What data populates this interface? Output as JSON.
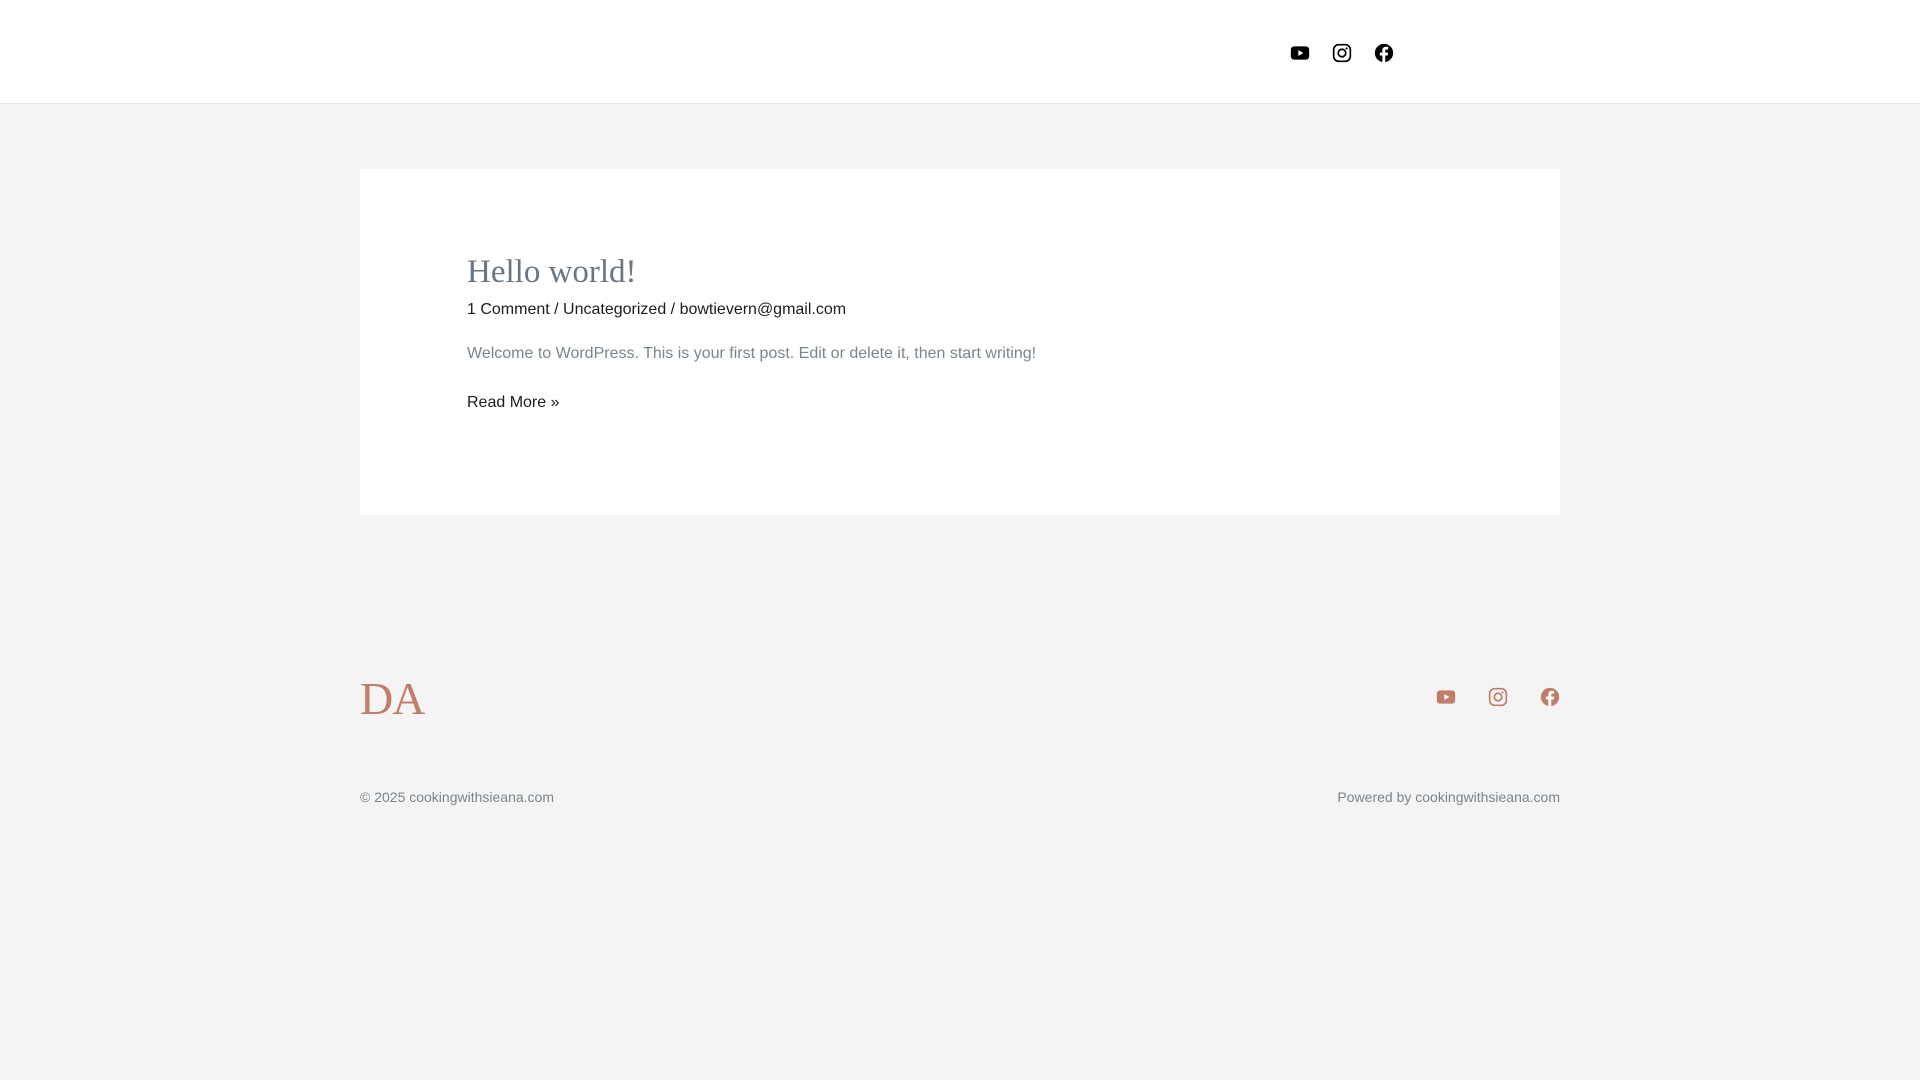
{
  "header": {
    "social": [
      "youtube-icon",
      "instagram-icon",
      "facebook-icon"
    ]
  },
  "post": {
    "title": "Hello world!",
    "comments": "1 Comment",
    "sep": " / ",
    "category": "Uncategorized",
    "author": "bowtievern@gmail.com",
    "excerpt": "Welcome to WordPress. This is your first post. Edit or delete it, then start writing!",
    "read_more": "Read More »"
  },
  "footer": {
    "logo": "DA",
    "copyright": "© 2025 cookingwithsieana.com",
    "powered": "Powered by cookingwithsieana.com",
    "accent": "#c17d69"
  }
}
